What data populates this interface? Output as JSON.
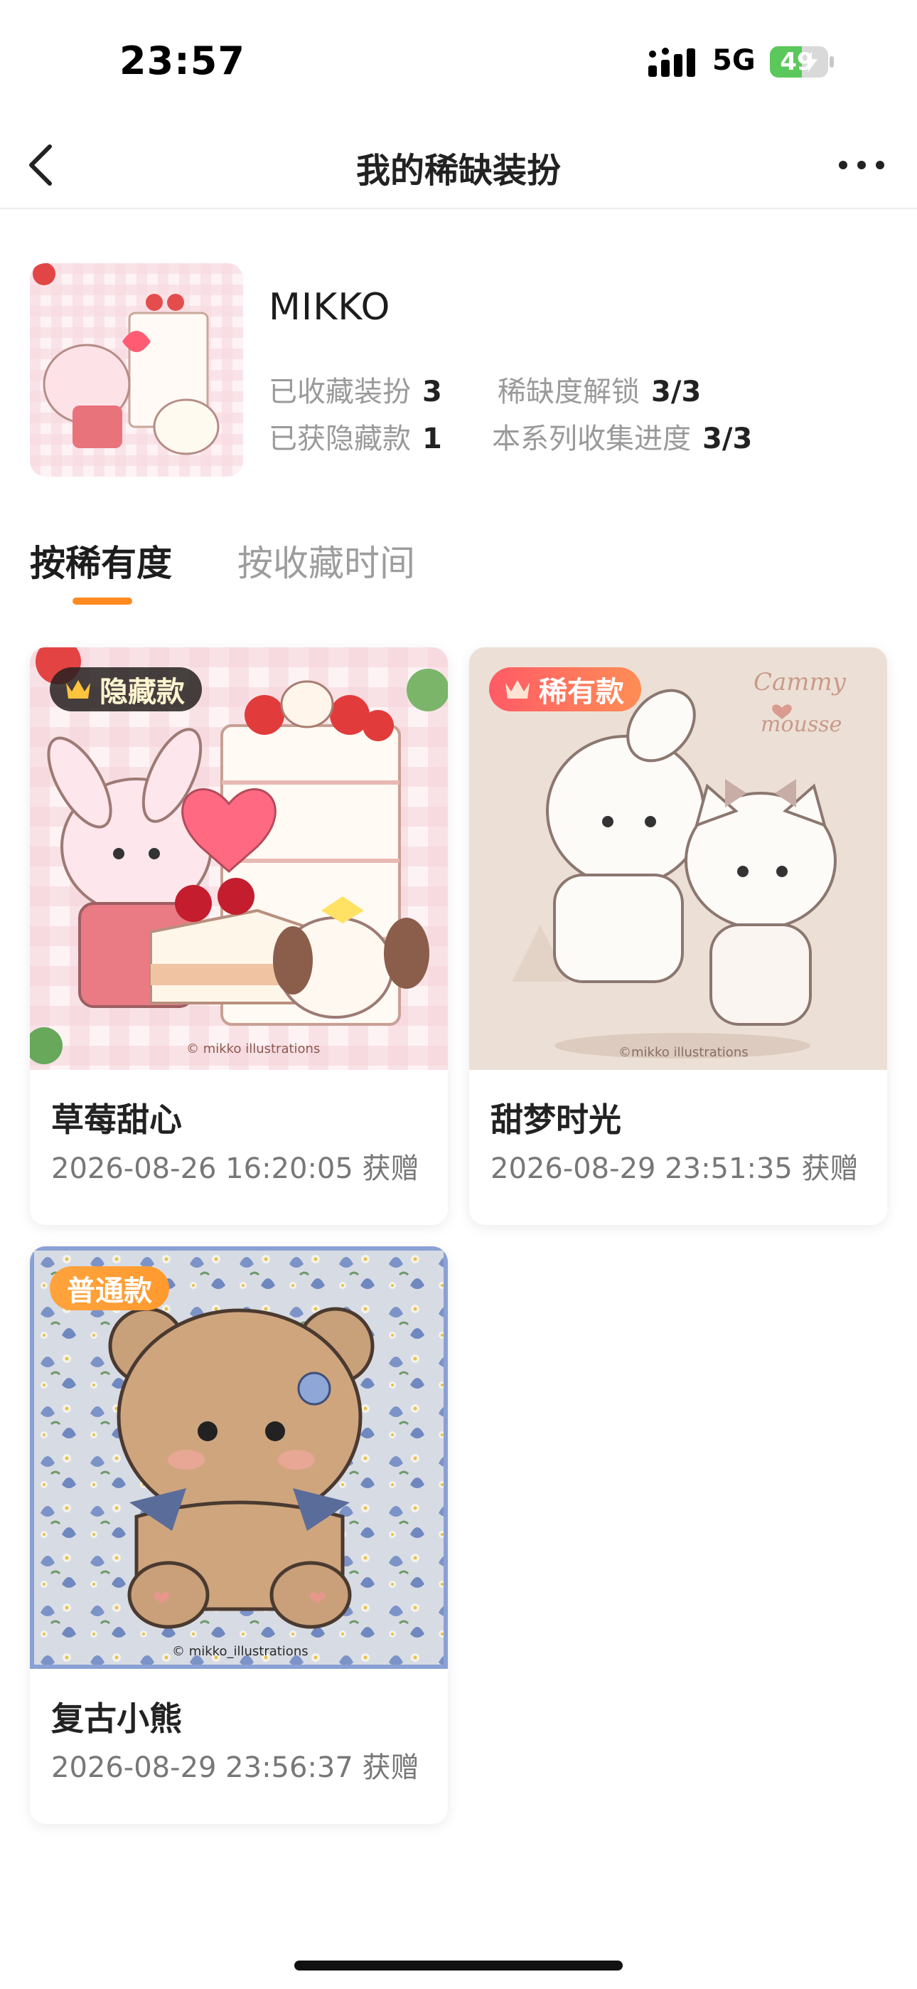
{
  "status_bar": {
    "time": "23:57",
    "network": "5G",
    "battery": "49"
  },
  "nav": {
    "title": "我的稀缺装扮"
  },
  "profile": {
    "name": "MIKKO",
    "stats": [
      {
        "label": "已收藏装扮",
        "value": "3"
      },
      {
        "label": "稀缺度解锁",
        "value": "3/3"
      },
      {
        "label": "已获隐藏款",
        "value": "1"
      },
      {
        "label": "本系列收集进度",
        "value": "3/3"
      }
    ]
  },
  "tabs": [
    {
      "label": "按稀有度",
      "active": true
    },
    {
      "label": "按收藏时间",
      "active": false
    }
  ],
  "items": [
    {
      "badge": "隐藏款",
      "title": "草莓甜心",
      "meta": "2026-08-26 16:20:05 获赠",
      "image_credit": "© mikko illustrations"
    },
    {
      "badge": "稀有款",
      "title": "甜梦时光",
      "meta": "2026-08-29 23:51:35 获赠",
      "image_credit": "©mikko illustrations",
      "image_logo": [
        "Cammy",
        "mousse"
      ]
    },
    {
      "badge": "普通款",
      "title": "复古小熊",
      "meta": "2026-08-29 23:56:37 获赠",
      "image_credit": "© mikko_illustrations"
    }
  ],
  "colors": {
    "accent": "#ff8a1f",
    "rare_badge": "#ff6a5c",
    "normal_badge": "#ffa03a",
    "hidden_badge": "#2b2624"
  }
}
